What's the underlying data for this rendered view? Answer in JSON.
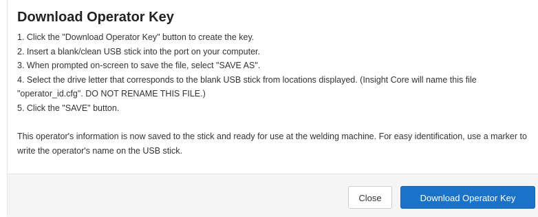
{
  "dialog": {
    "title": "Download Operator Key",
    "steps": [
      "1. Click the \"Download Operator Key\" button to create the key.",
      "2. Insert a blank/clean USB stick into the port on your computer.",
      "3. When prompted on-screen to save the file, select \"SAVE AS\".",
      "4. Select the drive letter that corresponds to the blank USB stick from locations displayed. (Insight Core will name this file \"operator_id.cfg\". DO NOT RENAME THIS FILE.)",
      "5. Click the \"SAVE\" button."
    ],
    "note": "This operator's information is now saved to the stick and ready for use at the welding machine. For easy identification, use a marker to write the operator's name on the USB stick."
  },
  "footer": {
    "close_label": "Close",
    "download_label": "Download Operator Key"
  },
  "colors": {
    "primary_button": "#1a73c8",
    "footer_background": "#f5f5f5"
  }
}
